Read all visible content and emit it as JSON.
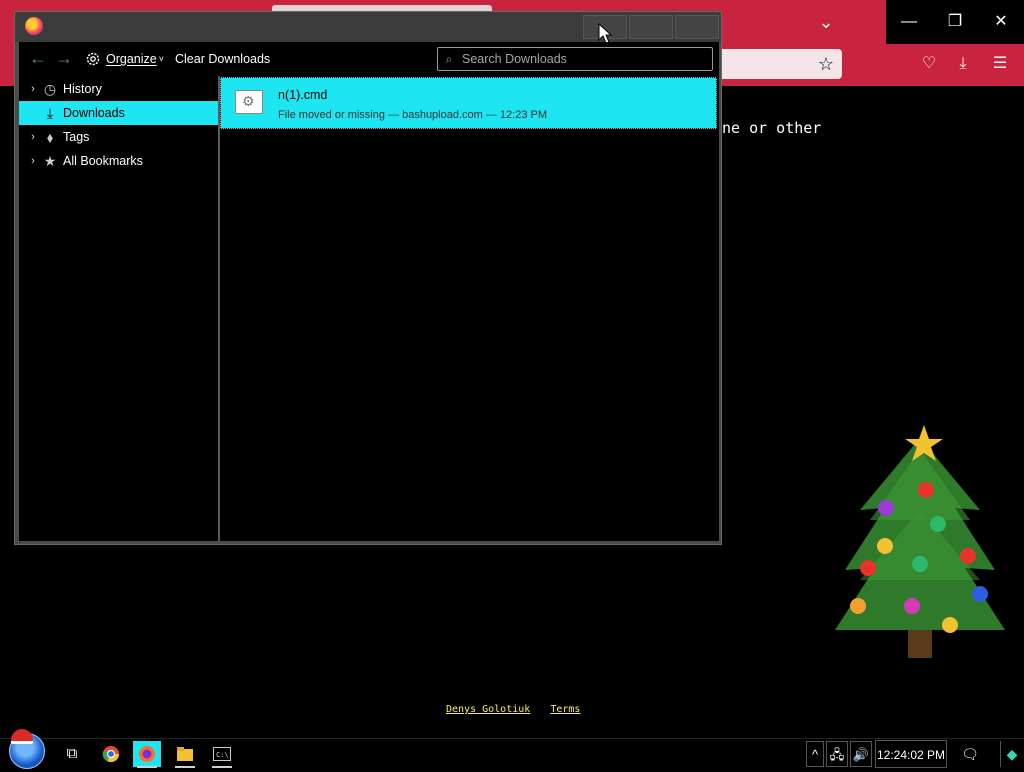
{
  "colors": {
    "accent": "#1ee5f2",
    "firefox_red": "#c8233f",
    "footer_link": "#f7f34d"
  },
  "background_page": {
    "visible_text": "ne or other",
    "footer_links": [
      "Denys Golotiuk",
      "Terms"
    ]
  },
  "library": {
    "toolbar": {
      "organize_label": "Organize",
      "organize_caret": "˅",
      "clear_downloads_label": "Clear Downloads",
      "search_placeholder": "Search Downloads"
    },
    "sidebar": {
      "items": [
        {
          "label": "History",
          "icon": "clock-icon",
          "expandable": true,
          "selected": false
        },
        {
          "label": "Downloads",
          "icon": "download-icon",
          "expandable": false,
          "selected": true
        },
        {
          "label": "Tags",
          "icon": "tag-icon",
          "expandable": true,
          "selected": false
        },
        {
          "label": "All Bookmarks",
          "icon": "star-icon",
          "expandable": true,
          "selected": false
        }
      ]
    },
    "downloads": [
      {
        "name": "n(1).cmd",
        "status": "File moved or missing — bashupload.com — 12:23 PM",
        "icon": "cmd-file-icon"
      }
    ]
  },
  "taskbar": {
    "apps": [
      "task-view",
      "chrome",
      "firefox",
      "file-explorer",
      "terminal"
    ],
    "active_app": "firefox",
    "clock": "12:24:02 PM"
  }
}
